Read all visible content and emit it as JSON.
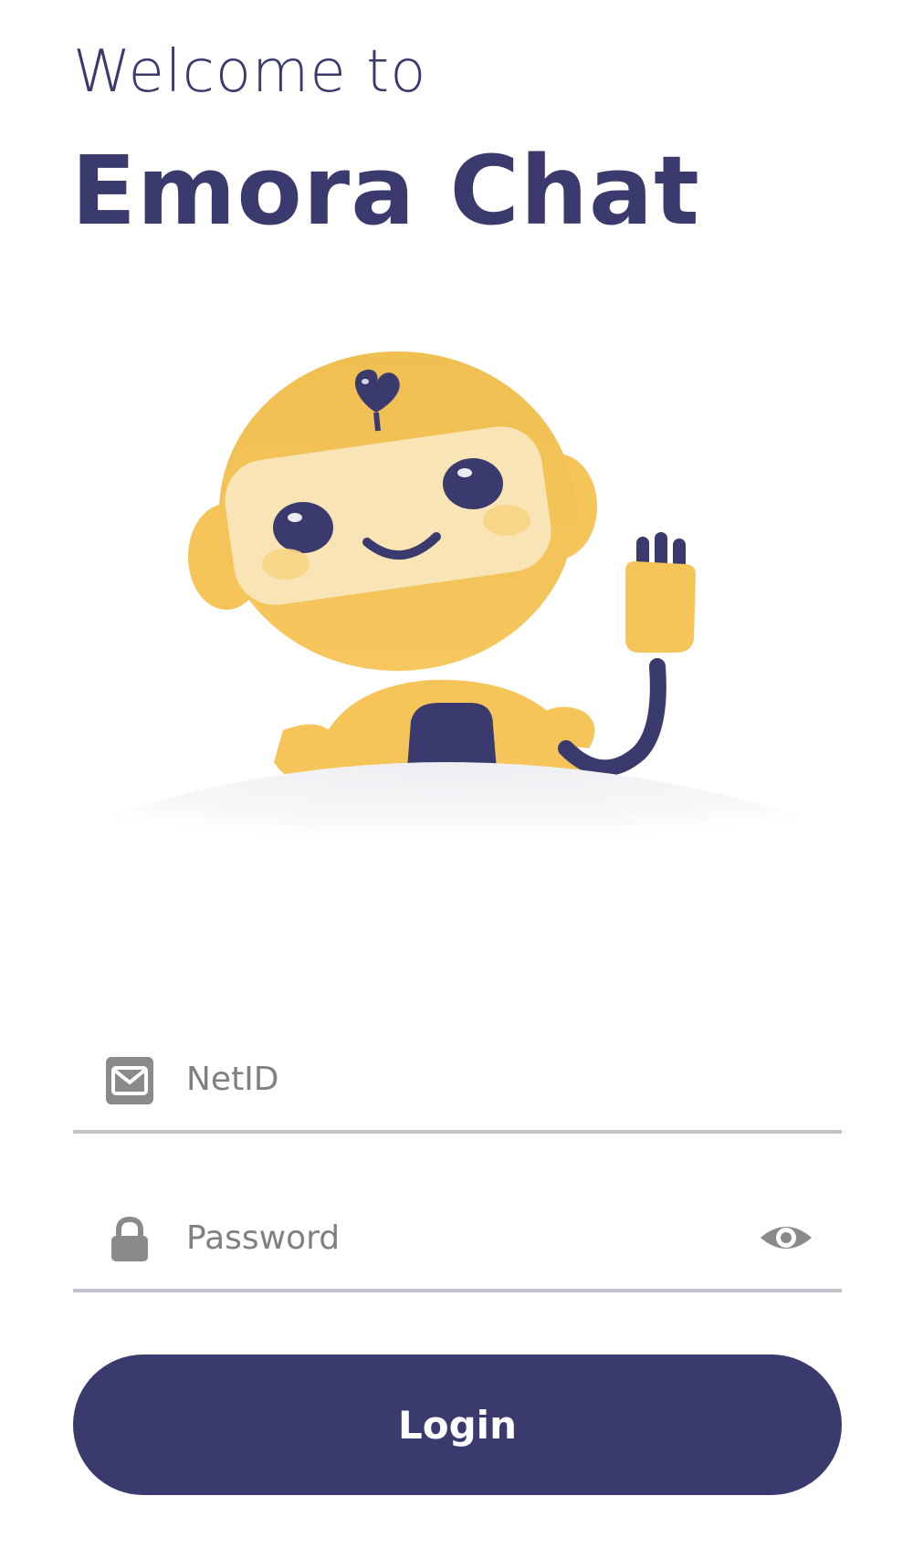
{
  "header": {
    "welcome": "Welcome to",
    "app_name": "Emora Chat"
  },
  "form": {
    "netid": {
      "placeholder": "NetID",
      "icon": "envelope-icon",
      "value": ""
    },
    "password": {
      "placeholder": "Password",
      "icon": "lock-icon",
      "toggle_icon": "eye-icon",
      "value": ""
    },
    "login_label": "Login"
  },
  "colors": {
    "primary": "#3b3a6e",
    "robot_yellow": "#f5c55a",
    "divider": "#bfc3c9",
    "icon_gray": "#8a8a8a"
  }
}
